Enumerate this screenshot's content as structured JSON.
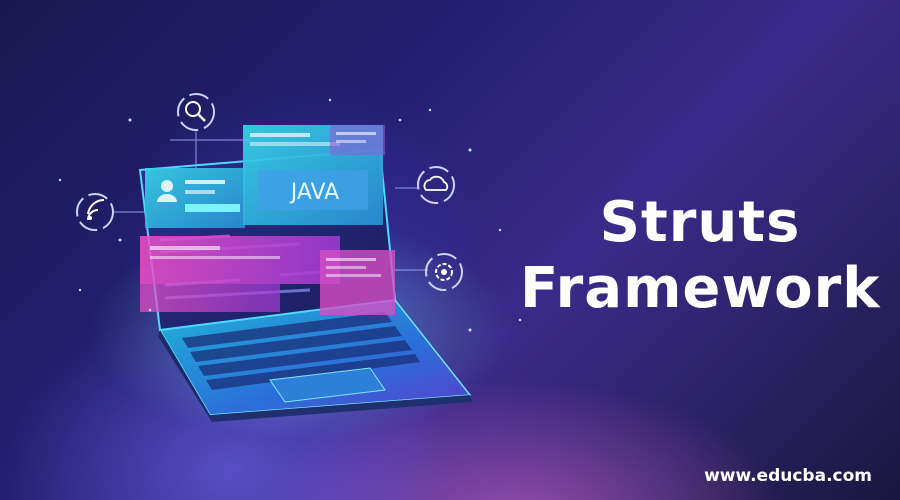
{
  "headline": {
    "line1": "Struts",
    "line2": "Framework"
  },
  "website": "www.educba.com",
  "illustration": {
    "screen_label": "JAVA",
    "icons": [
      "search-icon",
      "wifi-icon",
      "cloud-icon",
      "gear-icon",
      "user-icon"
    ]
  },
  "colors": {
    "background": "#251f72",
    "accent_cyan": "#3ff0e6",
    "accent_pink": "#e84fd0",
    "text": "#ffffff"
  }
}
